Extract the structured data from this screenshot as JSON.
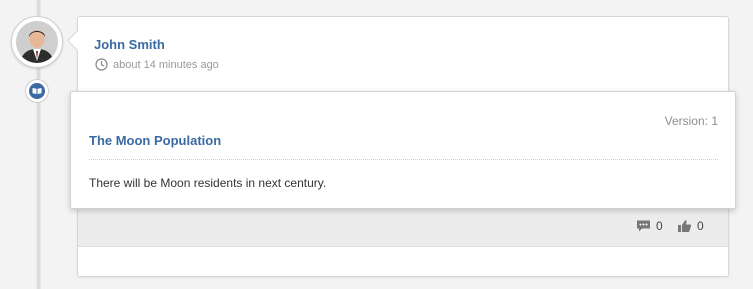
{
  "post": {
    "author": "John Smith",
    "time": "about 14 minutes ago"
  },
  "item": {
    "version": "Version: 1",
    "title": "The Moon Population",
    "body": "There will be Moon residents in next century."
  },
  "actions": {
    "comments_count": "0",
    "likes_count": "0"
  },
  "colors": {
    "accent": "#3a6aa3",
    "badge": "#3d6aa4"
  },
  "icons": [
    "clock-icon",
    "book-icon",
    "comment-icon",
    "thumbs-up-icon"
  ]
}
